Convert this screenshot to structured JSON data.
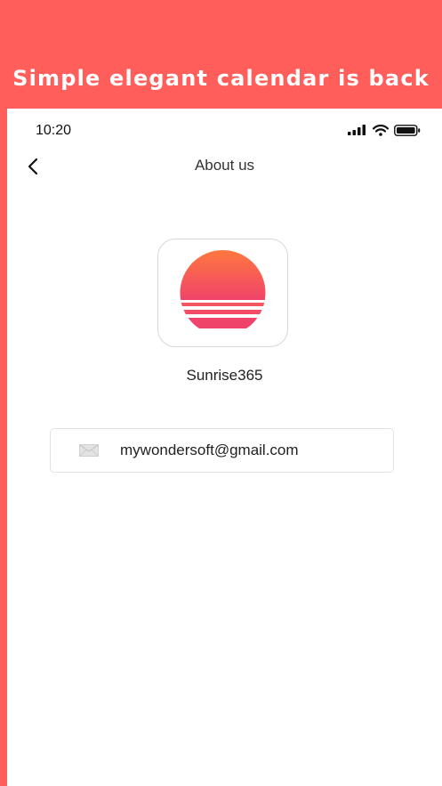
{
  "banner": {
    "title": "Simple elegant calendar is back"
  },
  "status_bar": {
    "time": "10:20"
  },
  "nav": {
    "title": "About us",
    "back_icon": "chevron-left-icon"
  },
  "app": {
    "name": "Sunrise365",
    "icon": "sunrise-logo-icon"
  },
  "contact": {
    "email": "mywondersoft@gmail.com",
    "icon": "mail-icon"
  },
  "colors": {
    "background": "#FF5E5B",
    "logo_top": "#FF7A3D",
    "logo_bottom": "#F0436A"
  }
}
